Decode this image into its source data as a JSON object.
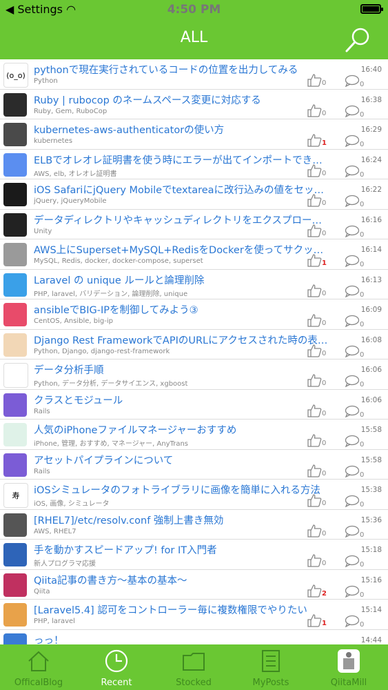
{
  "status": {
    "back": "Settings",
    "time": "4:50 PM"
  },
  "nav": {
    "title": "ALL"
  },
  "posts": [
    {
      "title": "pythonで現在実行されているコードの位置を出力してみる",
      "tags": "Python",
      "time": "16:40",
      "likes": "0",
      "comments": "0",
      "avatar": "(o_o)",
      "bg": "#ffffff",
      "fg": "#000000"
    },
    {
      "title": "Ruby | rubocop のネームスペース変更に対応する",
      "tags": "Ruby, Gem, RuboCop",
      "time": "16:38",
      "likes": "0",
      "comments": "0",
      "avatar": "",
      "bg": "#2b2b2b",
      "fg": "#ffffff"
    },
    {
      "title": "kubernetes-aws-authenticatorの使い方",
      "tags": "kubernetes",
      "time": "16:29",
      "likes": "1",
      "comments": "0",
      "avatar": "",
      "bg": "#4a4a4a",
      "fg": "#ffffff"
    },
    {
      "title": "ELBでオレオレ証明書を使う時にエラーが出てインポートできない…",
      "tags": "AWS, elb, オレオレ証明書",
      "time": "16:24",
      "likes": "0",
      "comments": "0",
      "avatar": "",
      "bg": "#5b8ef0",
      "fg": "#ffffff"
    },
    {
      "title": "iOS SafariにjQuery Mobileでtextareaに改行込みの値をセットする",
      "tags": "jQuery, jQueryMobile",
      "time": "16:22",
      "likes": "0",
      "comments": "0",
      "avatar": "",
      "bg": "#1a1a1a",
      "fg": "#ffffff"
    },
    {
      "title": "データディレクトリやキャッシュディレクトリをエクスプローラで…",
      "tags": "Unity",
      "time": "16:16",
      "likes": "0",
      "comments": "0",
      "avatar": "",
      "bg": "#222222",
      "fg": "#ffffff"
    },
    {
      "title": "AWS上にSuperset+MySQL+RedisをDockerを使ってサクッと…",
      "tags": "MySQL, Redis, docker, docker-compose, superset",
      "time": "16:14",
      "likes": "1",
      "comments": "0",
      "avatar": "",
      "bg": "#9a9a9a",
      "fg": "#ffffff"
    },
    {
      "title": "Laravel の unique ルールと論理削除",
      "tags": "PHP, laravel, バリデーション, 論理削除, unique",
      "time": "16:13",
      "likes": "0",
      "comments": "0",
      "avatar": "",
      "bg": "#3aa0e8",
      "fg": "#ffffff"
    },
    {
      "title": "ansibleでBIG-IPを制御してみよう③",
      "tags": "CentOS, Ansible, big-ip",
      "time": "16:09",
      "likes": "0",
      "comments": "0",
      "avatar": "",
      "bg": "#e84b6a",
      "fg": "#ffffff"
    },
    {
      "title": "Django Rest FrameworkでAPIのURLにアクセスされた時の表示…",
      "tags": "Python, Django, django-rest-framework",
      "time": "16:08",
      "likes": "0",
      "comments": "0",
      "avatar": "",
      "bg": "#f2d7b6",
      "fg": "#000000"
    },
    {
      "title": "データ分析手順",
      "tags": "Python, データ分析, データサイエンス, xgboost",
      "time": "16:06",
      "likes": "0",
      "comments": "0",
      "avatar": "",
      "bg": "#ffffff",
      "fg": "#000000"
    },
    {
      "title": "クラスとモジュール",
      "tags": "Rails",
      "time": "16:06",
      "likes": "0",
      "comments": "0",
      "avatar": "",
      "bg": "#7b5cd6",
      "fg": "#ffffff"
    },
    {
      "title": "人気のiPhoneファイルマネージャーおすすめ",
      "tags": "iPhone, 管理, おすすめ, マネージャー, AnyTrans",
      "time": "15:58",
      "likes": "0",
      "comments": "0",
      "avatar": "",
      "bg": "#dff2e8",
      "fg": "#000000"
    },
    {
      "title": "アセットパイプラインについて",
      "tags": "Rails",
      "time": "15:58",
      "likes": "0",
      "comments": "0",
      "avatar": "",
      "bg": "#7b5cd6",
      "fg": "#ffffff"
    },
    {
      "title": "iOSシミュレータのフォトライブラリに画像を簡単に入れる方法",
      "tags": "iOS, 画像, シミュレータ",
      "time": "15:38",
      "likes": "0",
      "comments": "0",
      "avatar": "寿",
      "bg": "#ffffff",
      "fg": "#000000"
    },
    {
      "title": "[RHEL7]/etc/resolv.conf 強制上書き無効",
      "tags": "AWS, RHEL7",
      "time": "15:36",
      "likes": "0",
      "comments": "0",
      "avatar": "",
      "bg": "#555555",
      "fg": "#ffffff"
    },
    {
      "title": "手を動かすスピードアップ! for IT入門者",
      "tags": "新人プログラマ応援",
      "time": "15:18",
      "likes": "0",
      "comments": "0",
      "avatar": "",
      "bg": "#2e64b8",
      "fg": "#ffffff"
    },
    {
      "title": "Qiita記事の書き方〜基本の基本〜",
      "tags": "Qiita",
      "time": "15:16",
      "likes": "2",
      "comments": "0",
      "avatar": "",
      "bg": "#c03060",
      "fg": "#ffffff"
    },
    {
      "title": "[Laravel5.4] 認可をコントローラー毎に複数権限でやりたい",
      "tags": "PHP, laravel",
      "time": "15:14",
      "likes": "1",
      "comments": "0",
      "avatar": "",
      "bg": "#e8a24a",
      "fg": "#ffffff"
    },
    {
      "title": "っっ！",
      "tags": "",
      "time": "14:44",
      "likes": "0",
      "comments": "0",
      "avatar": "",
      "bg": "#3a7bd5",
      "fg": "#ffffff"
    }
  ],
  "tabs": [
    {
      "label": "OfficalBlog",
      "icon": "house-icon"
    },
    {
      "label": "Recent",
      "icon": "clock-icon"
    },
    {
      "label": "Stocked",
      "icon": "folder-icon"
    },
    {
      "label": "MyPosts",
      "icon": "document-icon"
    },
    {
      "label": "QiitaMill",
      "icon": "mill-icon"
    }
  ]
}
